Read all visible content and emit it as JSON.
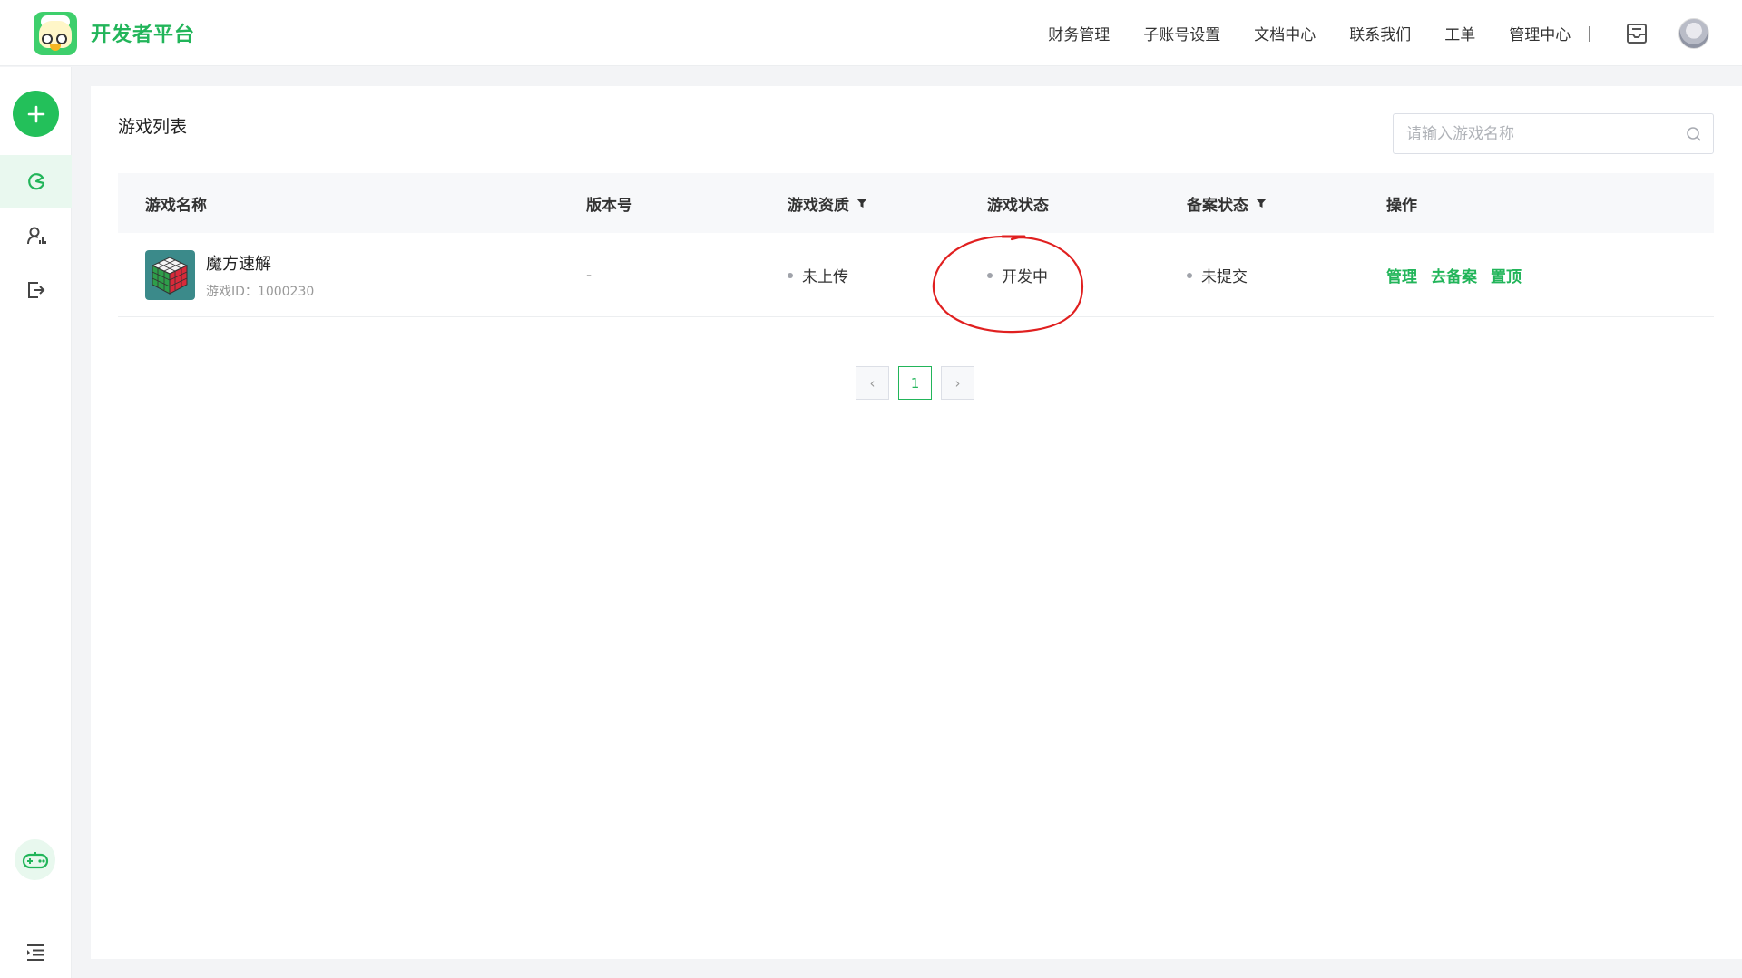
{
  "header": {
    "brand": "开发者平台",
    "nav": [
      "财务管理",
      "子账号设置",
      "文档中心",
      "联系我们",
      "工单",
      "管理中心"
    ],
    "separator": "|"
  },
  "sidebar": {
    "items": [
      "add-icon",
      "game-stats-icon",
      "user-data-icon",
      "exit-icon"
    ],
    "bottom": [
      "gamepad-icon",
      "menu-collapse-icon"
    ]
  },
  "main": {
    "title": "游戏列表",
    "search_placeholder": "请输入游戏名称",
    "columns": [
      "游戏名称",
      "版本号",
      "游戏资质",
      "游戏状态",
      "备案状态",
      "操作"
    ],
    "rows": [
      {
        "name": "魔方速解",
        "game_id": "游戏ID：1000230",
        "version": "-",
        "qualification": "未上传",
        "status": "开发中",
        "filing": "未提交",
        "actions": [
          "管理",
          "去备案",
          "置顶"
        ]
      }
    ],
    "pagination": {
      "prev": "‹",
      "current": "1",
      "next": "›"
    }
  },
  "colors": {
    "accent": "#22b55a",
    "annotation": "#e02020"
  }
}
